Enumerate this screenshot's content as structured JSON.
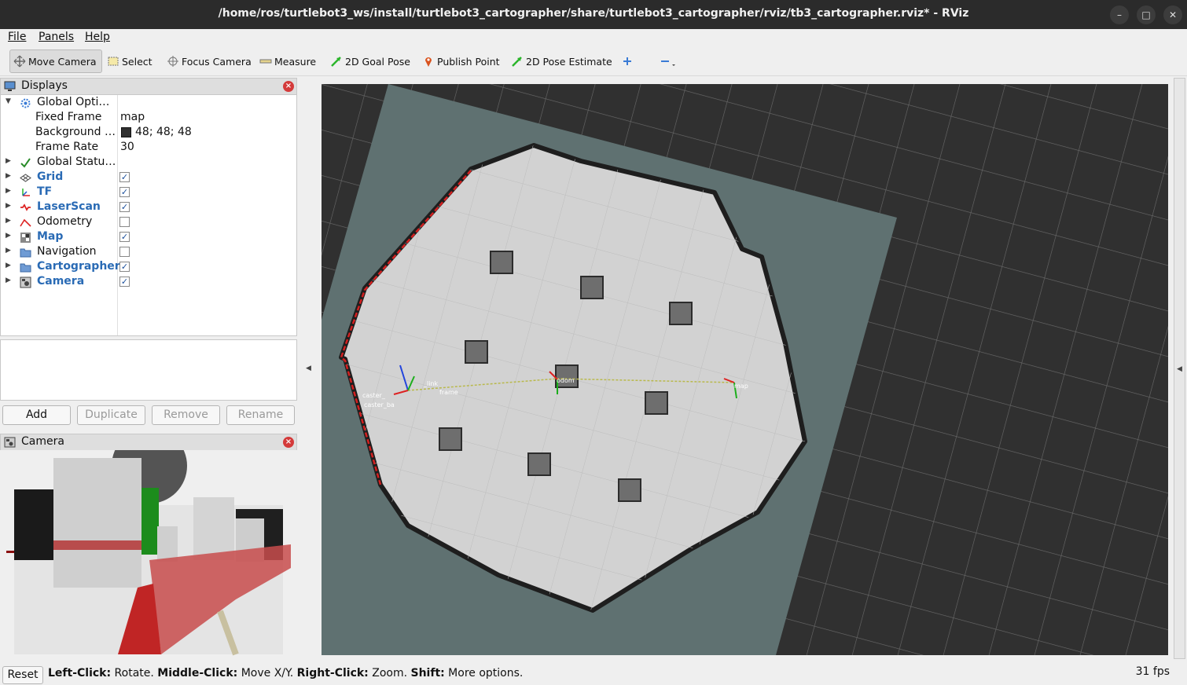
{
  "window": {
    "title": "/home/ros/turtlebot3_ws/install/turtlebot3_cartographer/share/turtlebot3_cartographer/rviz/tb3_cartographer.rviz* - RViz",
    "minimize": "–",
    "maximize": "□",
    "close": "✕"
  },
  "menu": {
    "file": "File",
    "panels": "Panels",
    "help": "Help"
  },
  "toolbar": {
    "move_camera": "Move Camera",
    "select": "Select",
    "focus_camera": "Focus Camera",
    "measure": "Measure",
    "goal_pose": "2D Goal Pose",
    "publish_point": "Publish Point",
    "pose_estimate": "2D Pose Estimate"
  },
  "displays": {
    "title": "Displays",
    "global_options": "Global Opti…",
    "fixed_frame_label": "Fixed Frame",
    "fixed_frame_value": "map",
    "background_label": "Background …",
    "background_value": "48; 48; 48",
    "frame_rate_label": "Frame Rate",
    "frame_rate_value": "30",
    "global_status": "Global Statu…",
    "items": [
      {
        "label": "Grid",
        "checked": true
      },
      {
        "label": "TF",
        "checked": true
      },
      {
        "label": "LaserScan",
        "checked": true
      },
      {
        "label": "Odometry",
        "checked": false
      },
      {
        "label": "Map",
        "checked": true
      },
      {
        "label": "Navigation",
        "checked": false
      },
      {
        "label": "Cartographer",
        "checked": true
      },
      {
        "label": "Camera",
        "checked": true
      }
    ]
  },
  "buttons": {
    "add": "Add",
    "duplicate": "Duplicate",
    "remove": "Remove",
    "rename": "Rename"
  },
  "camera_panel": {
    "title": "Camera"
  },
  "viewport_labels": {
    "odom": "odom",
    "map": "map",
    "caster_1": "caster_",
    "caster_2": "caster_ba",
    "link": "_link",
    "frame": "frame"
  },
  "status": {
    "reset": "Reset",
    "left_key": "Left-Click:",
    "left_val": " Rotate. ",
    "middle_key": "Middle-Click:",
    "middle_val": " Move X/Y. ",
    "right_key": "Right-Click:",
    "right_val": " Zoom. ",
    "shift_key": "Shift:",
    "shift_val": " More options.",
    "fps": "31 fps"
  },
  "colors": {
    "background": "#303030",
    "free_space": "#d2d2d2",
    "unknown": "#5f7171",
    "accent": "#2a6bb5"
  }
}
